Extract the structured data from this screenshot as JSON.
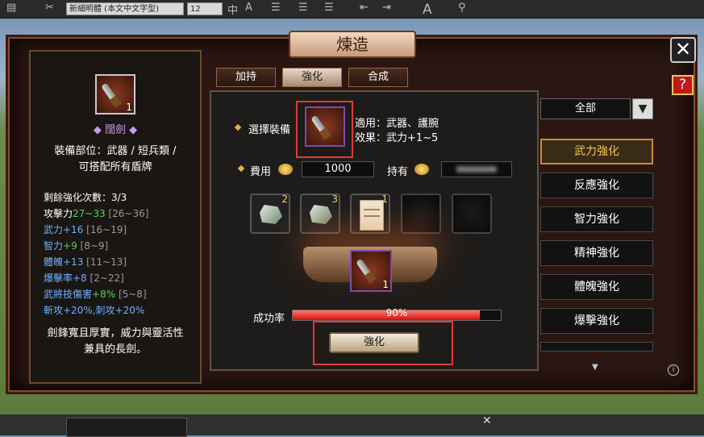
{
  "toolbar": {
    "font_name": "新細明體 (本文中文字型)",
    "font_size": "12"
  },
  "dialog": {
    "title": "煉造",
    "close_label": "✕",
    "help_label": "?"
  },
  "tabs": [
    {
      "label": "加持",
      "active": false
    },
    {
      "label": "強化",
      "active": true
    },
    {
      "label": "合成",
      "active": false
    }
  ],
  "item": {
    "quantity": "1",
    "name": "闊劍",
    "equip_part": "裝備部位：武器 / 短兵類 /",
    "equip_part_2": "可搭配所有盾牌",
    "remaining_enhance": "剩餘強化次數：3/3",
    "attack_label": "攻擊力",
    "attack_value": "27~33",
    "attack_range": "[26~36]",
    "stats": [
      {
        "name": "武力+16",
        "range": "[16~19]"
      },
      {
        "name": "智力",
        "bonus": "+9",
        "range": "[8~9]"
      },
      {
        "name": "體魄+13",
        "range": "[11~13]"
      },
      {
        "name": "爆擊率+8",
        "range": "[2~22]"
      }
    ],
    "skill_damage_label": "武將技傷害",
    "skill_damage_bonus": "+8%",
    "skill_damage_range": "[5~8]",
    "slash_pierce": "斬攻+20%,刺攻+20%",
    "description_1": "劍鋒寬且厚實，威力與靈活性",
    "description_2": "兼具的長劍。"
  },
  "enhance": {
    "select_equipment_label": "選擇裝備",
    "applicable": "適用：武器、護腕",
    "effect": "效果：武力+1~5",
    "cost_label": "費用",
    "cost_value": "1000",
    "owned_label": "持有",
    "materials": [
      {
        "qty": "2",
        "type": "ore"
      },
      {
        "qty": "3",
        "type": "ore"
      },
      {
        "qty": "1",
        "type": "scroll"
      },
      {
        "qty": "",
        "type": "empty"
      },
      {
        "qty": "",
        "type": "empty"
      }
    ],
    "result_qty": "1",
    "success_rate_label": "成功率",
    "success_rate_text": "90%",
    "success_rate_value": 0.9,
    "enhance_button": "強化"
  },
  "filter": {
    "selected": "全部",
    "arrow": "▼"
  },
  "categories": [
    {
      "label": "武力強化",
      "active": true
    },
    {
      "label": "反應強化",
      "active": false
    },
    {
      "label": "智力強化",
      "active": false
    },
    {
      "label": "精神強化",
      "active": false
    },
    {
      "label": "體魄強化",
      "active": false
    },
    {
      "label": "爆擊強化",
      "active": false
    }
  ],
  "colors": {
    "accent_red": "#e03a3a",
    "stat_green": "#58d05a",
    "stat_blue": "#6fb0ff",
    "gold": "#f0c84a"
  }
}
